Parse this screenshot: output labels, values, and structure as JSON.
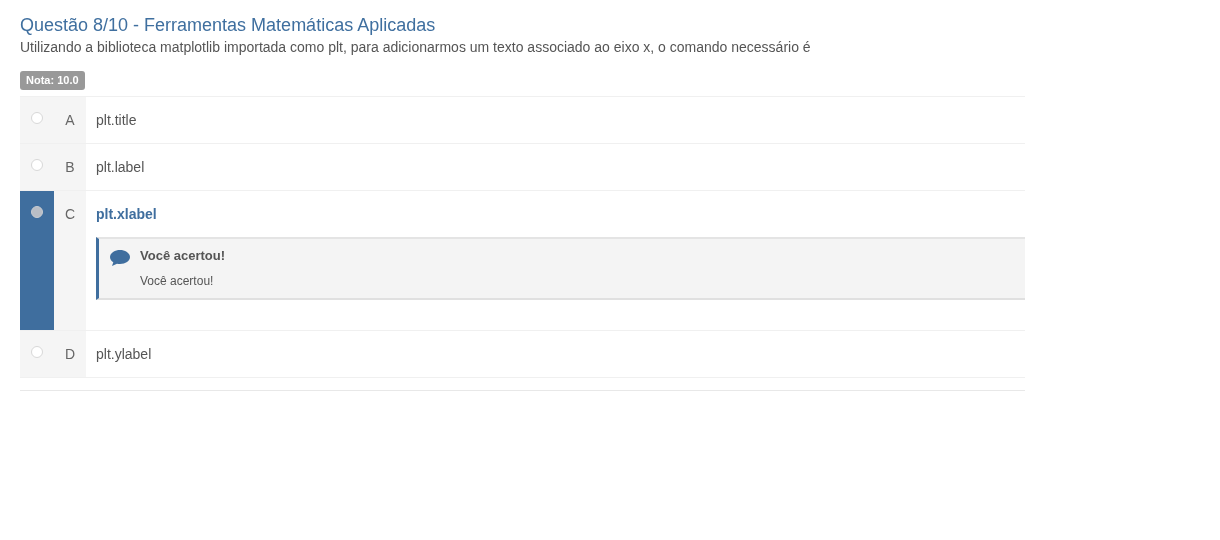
{
  "question": {
    "title": "Questão 8/10 - Ferramentas Matemáticas Aplicadas",
    "text": "Utilizando a biblioteca matplotlib importada como plt, para adicionarmos um texto associado ao eixo x, o comando necessário é"
  },
  "grade": "Nota: 10.0",
  "options": [
    {
      "letter": "A",
      "text": "plt.title",
      "selected": false
    },
    {
      "letter": "B",
      "text": "plt.label",
      "selected": false
    },
    {
      "letter": "C",
      "text": "plt.xlabel",
      "selected": true,
      "feedback": {
        "title": "Você acertou!",
        "body": "Você acertou!"
      }
    },
    {
      "letter": "D",
      "text": "plt.ylabel",
      "selected": false
    }
  ]
}
